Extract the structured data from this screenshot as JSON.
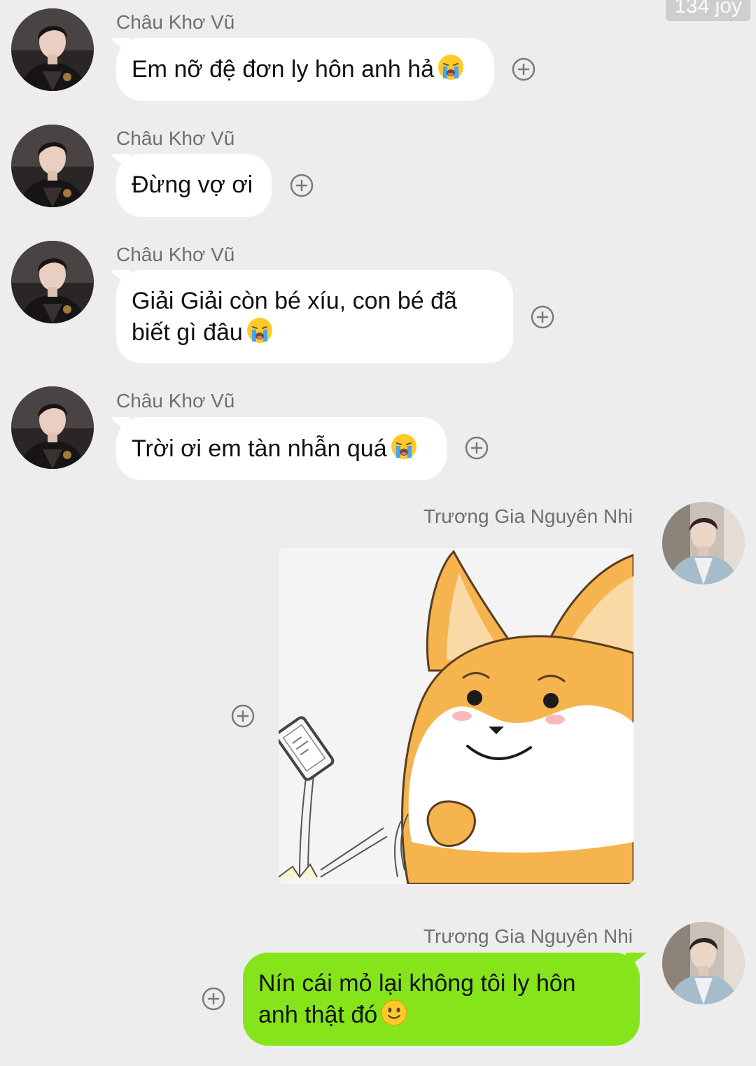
{
  "watermark": "134 joy",
  "messages": [
    {
      "sender": "Châu Khơ Vũ",
      "text": "Em nỡ đệ đơn ly hôn anh hả",
      "emoji": "crying-face-icon"
    },
    {
      "sender": "Châu Khơ Vũ",
      "text": "Đừng vợ ơi"
    },
    {
      "sender": "Châu Khơ Vũ",
      "text_line1": "Giải Giải còn bé xíu, con bé đã",
      "text_line2": "biết gì đâu",
      "emoji": "crying-face-icon"
    },
    {
      "sender": "Châu Khơ Vũ",
      "text": "Trời ơi em tàn nhẫn quá",
      "emoji": "crying-face-icon"
    },
    {
      "sender": "Trương Gia Nguyên Nhi",
      "type": "sticker",
      "sticker": "corgi-throwing-phone-sticker"
    },
    {
      "sender": "Trương Gia Nguyên Nhi",
      "text_line1": "Nín cái mỏ lại không tôi ly hôn",
      "text_line2": "anh thật đó",
      "emoji": "smiling-face-icon"
    }
  ],
  "colors": {
    "background": "#ededed",
    "incoming_bubble": "#ffffff",
    "outgoing_bubble": "#86e51a",
    "sender_name": "#6f6f6f"
  }
}
